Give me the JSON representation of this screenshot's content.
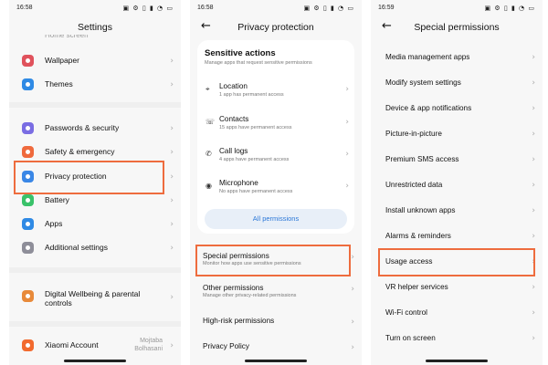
{
  "phone1": {
    "status": {
      "time": "16:58",
      "icons": "▣ ⚙ ▯ ▮ ◔ ▭"
    },
    "title": "Settings",
    "top_partial": "Home screen",
    "items": [
      {
        "label": "Wallpaper",
        "color": "#e0525c"
      },
      {
        "label": "Themes",
        "color": "#2f8ae5"
      },
      {
        "label": "Passwords & security",
        "color": "#7a6de3"
      },
      {
        "label": "Safety & emergency",
        "color": "#ef6a3d"
      },
      {
        "label": "Privacy protection",
        "color": "#3a87e6"
      },
      {
        "label": "Battery",
        "color": "#3ac26a"
      },
      {
        "label": "Apps",
        "color": "#2f8ae5"
      },
      {
        "label": "Additional settings",
        "color": "#8e8e99"
      },
      {
        "label": "Digital Wellbeing & parental controls",
        "color": "#e88a3a"
      },
      {
        "label": "Xiaomi Account",
        "color": "#f26a2e"
      }
    ],
    "account_name_1": "Mojtaba",
    "account_name_2": "Bolhasani"
  },
  "phone2": {
    "status": {
      "time": "16:58",
      "icons": "▣ ⚙ ▯ ▮ ◔ ▭"
    },
    "title": "Privacy protection",
    "card_title": "Sensitive actions",
    "card_subtitle": "Manage apps that request sensitive permissions",
    "perms": [
      {
        "title": "Location",
        "sub": "1 app has permanent access",
        "icon": "⌖"
      },
      {
        "title": "Contacts",
        "sub": "15 apps have permanent access",
        "icon": "☏"
      },
      {
        "title": "Call logs",
        "sub": "4 apps have permanent access",
        "icon": "✆"
      },
      {
        "title": "Microphone",
        "sub": "No apps have permanent access",
        "icon": "◉"
      }
    ],
    "all_permissions": "All permissions",
    "rows": [
      {
        "title": "Special permissions",
        "sub": "Monitor how apps use sensitive permissions"
      },
      {
        "title": "Other permissions",
        "sub": "Manage other privacy-related permissions"
      },
      {
        "title": "High-risk permissions",
        "sub": ""
      },
      {
        "title": "Privacy Policy",
        "sub": ""
      }
    ]
  },
  "phone3": {
    "status": {
      "time": "16:59",
      "icons": "▣ ⚙ ▯ ▮ ◔ ▭"
    },
    "title": "Special permissions",
    "items": [
      "Media management apps",
      "Modify system settings",
      "Device & app notifications",
      "Picture-in-picture",
      "Premium SMS access",
      "Unrestricted data",
      "Install unknown apps",
      "Alarms & reminders",
      "Usage access",
      "VR helper services",
      "Wi-Fi control",
      "Turn on screen"
    ]
  },
  "accent": "#ee6c3e",
  "link_color": "#2c78d8"
}
